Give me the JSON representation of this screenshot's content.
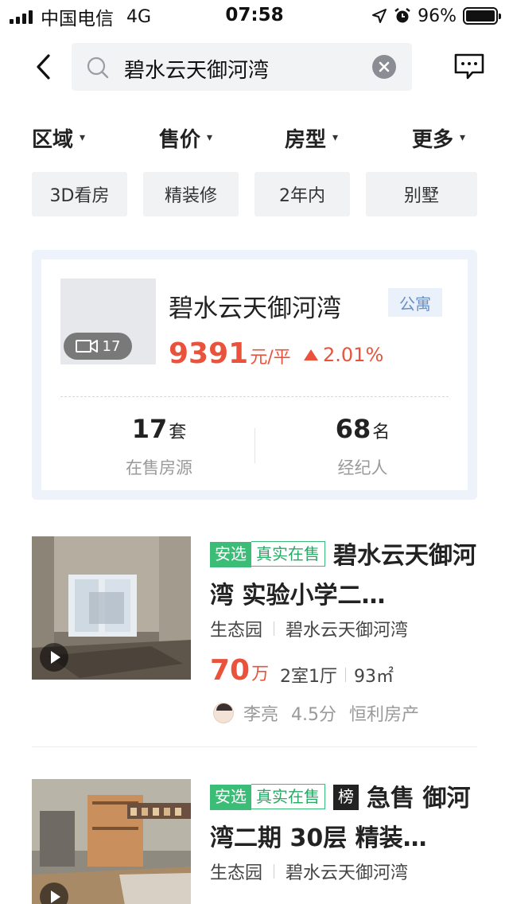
{
  "status_bar": {
    "carrier": "中国电信",
    "network": "4G",
    "time": "07:58",
    "battery": "96%",
    "icons": [
      "signal-icon",
      "location-icon",
      "alarm-icon",
      "battery-icon"
    ]
  },
  "header": {
    "search_value": "碧水云天御河湾",
    "icons": [
      "back-icon",
      "search-icon",
      "clear-icon",
      "message-icon"
    ]
  },
  "filters": [
    "区域",
    "售价",
    "房型",
    "更多"
  ],
  "chips": [
    "3D看房",
    "精装修",
    "2年内",
    "别墅"
  ],
  "estate": {
    "name": "碧水云天御河湾",
    "tag": "公寓",
    "video_count": "17",
    "price": "9391",
    "price_unit": "元/平",
    "change": "2.01%",
    "change_direction": "up",
    "stats": [
      {
        "value": "17",
        "suffix": "套",
        "label": "在售房源"
      },
      {
        "value": "68",
        "suffix": "名",
        "label": "经纪人"
      }
    ]
  },
  "listings": [
    {
      "badges": [
        "安选",
        "真实在售"
      ],
      "title": "碧水云天御河湾 实验小学二…",
      "district": "生态园",
      "community": "碧水云天御河湾",
      "price": "70",
      "price_unit": "万",
      "layout": "2室1厅",
      "area": "93㎡",
      "agent_name": "李亮",
      "agent_score": "4.5分",
      "agency": "恒利房产"
    },
    {
      "badges": [
        "安选",
        "真实在售"
      ],
      "rank_badge": "榜",
      "title": "急售 御河湾二期 30层 精装…",
      "district": "生态园",
      "community": "碧水云天御河湾"
    }
  ],
  "colors": {
    "price_red": "#e9533c",
    "badge_green": "#3bbd77",
    "tag_blue": "#6a90c8",
    "card_bg": "#eef2fb"
  }
}
